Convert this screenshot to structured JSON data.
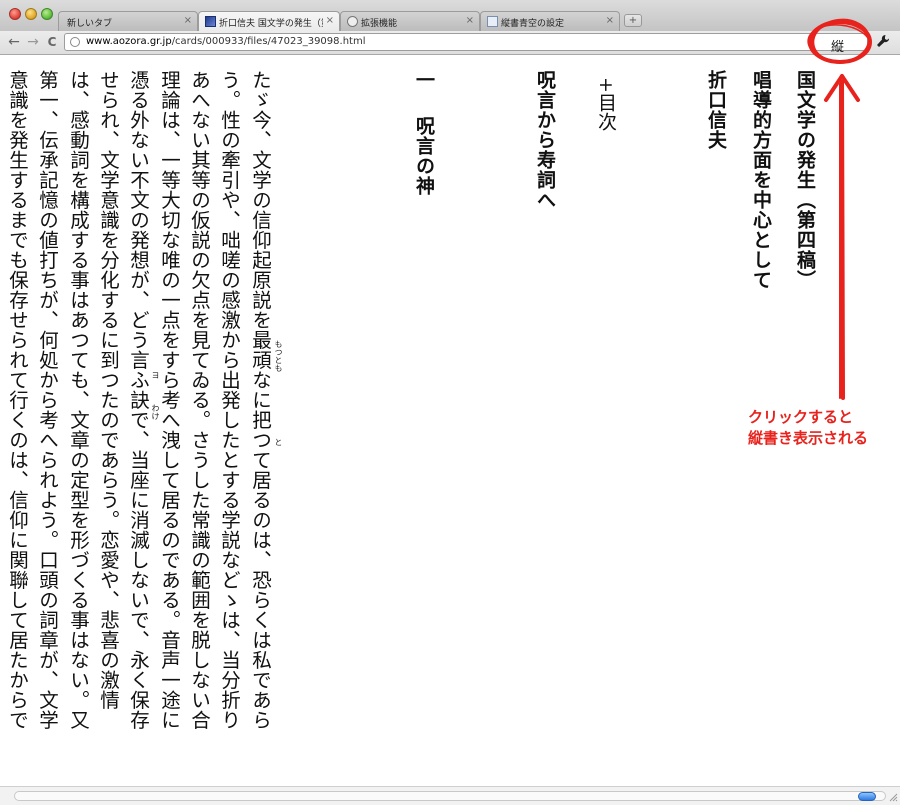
{
  "tabs": [
    {
      "label": "新しいタブ",
      "active": false,
      "favicon": ""
    },
    {
      "label": "折口信夫 国文学の発生（第四稿）",
      "active": true,
      "favicon": "aozora-icon"
    },
    {
      "label": "拡張機能",
      "active": false,
      "favicon": "puzzle-icon"
    },
    {
      "label": "縦書青空の設定",
      "active": false,
      "favicon": "page-icon"
    }
  ],
  "new_tab_symbol": "+",
  "close_symbol": "×",
  "toolbar": {
    "back_symbol": "←",
    "forward_symbol": "→",
    "reload_symbol": "C",
    "url_domain": "www.aozora.gr.jp",
    "url_path": "/cards/000933/files/47023_39098.html",
    "tate_button_label": "縦"
  },
  "document": {
    "title": "国文学の発生（第四稿）",
    "subtitle": "唱導的方面を中心として",
    "author": "折口信夫",
    "toc_label": "+目次",
    "chapter_title": "呪言から寿詞へ",
    "section_number": "一",
    "section_title": "呪言の神",
    "body_lines": [
      "たゞ今、文学の信仰起原説を最頑なに把つて居るのは、恐らくは私であら",
      "う。性の牽引や、咄嗟の感激から出発したとする学説などゝは、当分折り",
      "あへない其等の仮説の欠点を見てゐる。さうした常識の範囲を脱しない合",
      "理論は、一等大切な唯の一点をすら考へ洩して居るのである。音声一途に",
      "憑る外ない不文の発想が、どう言ふ訣で、当座に消滅しないで、永く保存",
      "せられ、文学意識を分化するに到つたのであらう。恋愛や、悲喜の激情",
      "は、感動詞を構成する事はあつても、文章の定型を形づくる事はない。又",
      "第一、伝承記憶の値打ちが、何処から考へられよう。口頭の詞章が、文学",
      "意識を発生するまでも保存せられて行くのは、信仰に関聯して居たからで"
    ],
    "ruby": [
      {
        "base": "最",
        "reading": "もつとも"
      },
      {
        "base": "把",
        "reading": "と"
      },
      {
        "base": "憑",
        "reading": "ヨ"
      },
      {
        "base": "訣",
        "reading": "わけ"
      }
    ]
  },
  "annotation": {
    "line1": "クリックすると",
    "line2": "縦書き表示される",
    "color": "#e8221c"
  },
  "scrollbar": {
    "position": 1.0
  }
}
